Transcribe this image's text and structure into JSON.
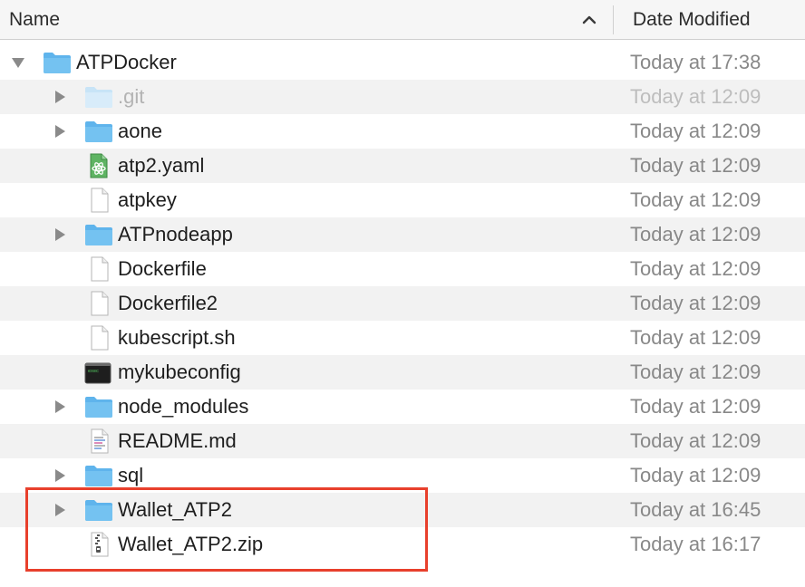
{
  "header": {
    "name_label": "Name",
    "date_label": "Date Modified",
    "sort_icon": "chevron-up-icon"
  },
  "rows": [
    {
      "name": "ATPDocker",
      "date": "Today at 17:38",
      "icon": "folder-icon",
      "disclosure": "expanded"
    },
    {
      "name": ".git",
      "date": "Today at 12:09",
      "icon": "folder-icon",
      "disclosure": "collapsed",
      "dimmed": true
    },
    {
      "name": "aone",
      "date": "Today at 12:09",
      "icon": "folder-icon",
      "disclosure": "collapsed"
    },
    {
      "name": "atp2.yaml",
      "date": "Today at 12:09",
      "icon": "atom-file-icon",
      "disclosure": "none"
    },
    {
      "name": "atpkey",
      "date": "Today at 12:09",
      "icon": "document-icon",
      "disclosure": "none"
    },
    {
      "name": "ATPnodeapp",
      "date": "Today at 12:09",
      "icon": "folder-icon",
      "disclosure": "collapsed"
    },
    {
      "name": "Dockerfile",
      "date": "Today at 12:09",
      "icon": "document-icon",
      "disclosure": "none"
    },
    {
      "name": "Dockerfile2",
      "date": "Today at 12:09",
      "icon": "document-icon",
      "disclosure": "none"
    },
    {
      "name": "kubescript.sh",
      "date": "Today at 12:09",
      "icon": "document-icon",
      "disclosure": "none"
    },
    {
      "name": "mykubeconfig",
      "date": "Today at 12:09",
      "icon": "terminal-icon",
      "disclosure": "none"
    },
    {
      "name": "node_modules",
      "date": "Today at 12:09",
      "icon": "folder-icon",
      "disclosure": "collapsed"
    },
    {
      "name": "README.md",
      "date": "Today at 12:09",
      "icon": "text-document-icon",
      "disclosure": "none"
    },
    {
      "name": "sql",
      "date": "Today at 12:09",
      "icon": "folder-icon",
      "disclosure": "collapsed"
    },
    {
      "name": "Wallet_ATP2",
      "date": "Today at 16:45",
      "icon": "folder-icon",
      "disclosure": "collapsed"
    },
    {
      "name": "Wallet_ATP2.zip",
      "date": "Today at 16:17",
      "icon": "zip-archive-icon",
      "disclosure": "none"
    }
  ],
  "colors": {
    "folder": "#5fb4ec",
    "highlight": "#e8402c",
    "date_text": "#888888"
  }
}
